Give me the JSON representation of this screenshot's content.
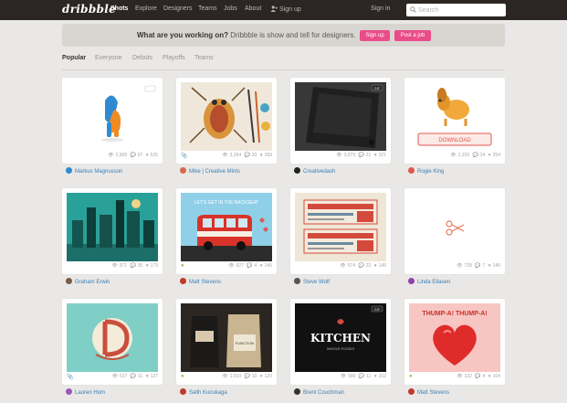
{
  "nav": {
    "logo": "dribbble",
    "items": [
      "Shots",
      "Explore",
      "Designers",
      "Teams",
      "Jobs",
      "About"
    ],
    "signup": "Sign up",
    "signin": "Sign in",
    "search_placeholder": "Search"
  },
  "banner": {
    "question": "What are you working on?",
    "tagline": "Dribbble is show and tell for designers.",
    "signup_button": "Sign up",
    "post_job_button": "Post a job"
  },
  "tabs": [
    "Popular",
    "Everyone",
    "Debuts",
    "Playoffs",
    "Teams"
  ],
  "shots": [
    {
      "views": "2,906",
      "comments": "97",
      "likes": "525",
      "author": "Markus Magnusson",
      "avatar_color": "#2f8bd1"
    },
    {
      "views": "3,264",
      "comments": "33",
      "likes": "399",
      "author": "Mike | Creative Mints",
      "avatar_color": "#d46b4b"
    },
    {
      "views": "3,079",
      "comments": "21",
      "likes": "321",
      "author": "Creativedash",
      "avatar_color": "#222222"
    },
    {
      "views": "2,330",
      "comments": "24",
      "likes": "254",
      "author": "Rogie King",
      "avatar_color": "#e0574d"
    },
    {
      "views": "971",
      "comments": "35",
      "likes": "173",
      "author": "Graham Erwin",
      "avatar_color": "#7a5c48"
    },
    {
      "views": "927",
      "comments": "4",
      "likes": "145",
      "author": "Matt Stevens",
      "avatar_color": "#c0392b"
    },
    {
      "views": "674",
      "comments": "22",
      "likes": "145",
      "author": "Steve Wolf",
      "avatar_color": "#555555"
    },
    {
      "views": "728",
      "comments": "7",
      "likes": "140",
      "author": "Linda Eliasen",
      "avatar_color": "#8e44ad"
    },
    {
      "views": "617",
      "comments": "11",
      "likes": "127",
      "author": "Lauren Hom",
      "avatar_color": "#9b59b6"
    },
    {
      "views": "1,010",
      "comments": "10",
      "likes": "120",
      "author": "Salih Kucukaga",
      "avatar_color": "#c0392b"
    },
    {
      "views": "580",
      "comments": "11",
      "likes": "102",
      "author": "Brent Couchman",
      "avatar_color": "#333333"
    },
    {
      "views": "332",
      "comments": "4",
      "likes": "104",
      "author": "Matt Stevens",
      "avatar_color": "#c0392b"
    }
  ],
  "thumb_text": {
    "gif": "GIF",
    "download": "DOWNLOAD",
    "bus_banner": "LET'S GET IN THE BACKSEAT",
    "kitchen": "KITCHEN",
    "kitchen_sub": "WHOLE FOODS",
    "thump": "THUMP-A! THUMP-A!",
    "function": "FUNCTION"
  },
  "colors": {
    "topbar": "#2b2623",
    "accent_pink": "#ea4c89",
    "link_blue": "#3a7fb5"
  }
}
